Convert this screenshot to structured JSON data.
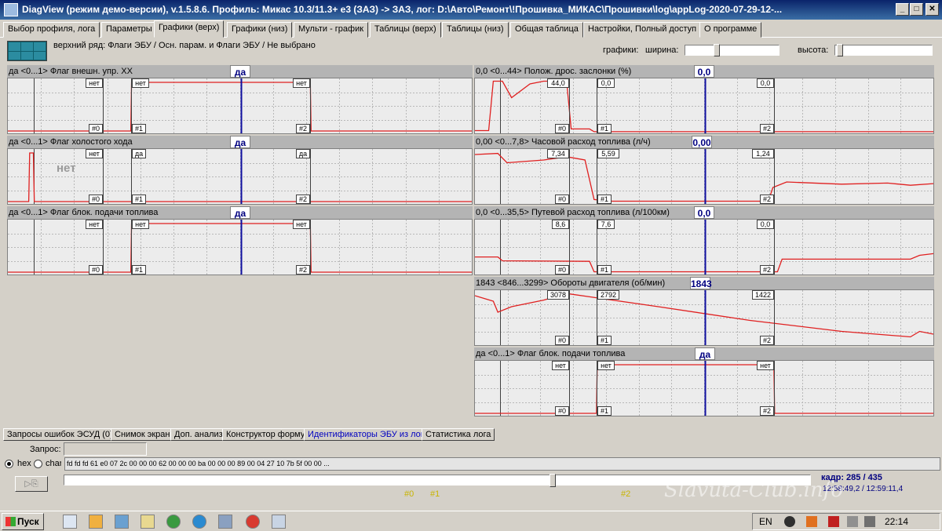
{
  "window": {
    "title": "DiagView (режим демо-версии), v.1.5.8.6. Профиль: Микас 10.3/11.3+ е3 (ЗАЗ) -> ЗАЗ,   лог: D:\\Авто\\Ремонт\\!Прошивка_МИКАС\\Прошивки\\log\\appLog-2020-07-29-12-...",
    "min_label": "_",
    "max_label": "□",
    "close_label": "✕"
  },
  "tabs": [
    {
      "label": "Выбор профиля, лога",
      "active": false
    },
    {
      "label": "Параметры",
      "active": false
    },
    {
      "label": "Графики (верх)",
      "active": true
    },
    {
      "label": "Графики (низ)",
      "active": false
    },
    {
      "label": "Мульти - график",
      "active": false
    },
    {
      "label": "Таблицы (верх)",
      "active": false
    },
    {
      "label": "Таблицы (низ)",
      "active": false
    },
    {
      "label": "Общая таблица",
      "active": false
    },
    {
      "label": "Настройки, Полный доступ",
      "active": false
    },
    {
      "label": "О программе",
      "active": false
    }
  ],
  "subheader": {
    "row_desc": "верхний ряд: Флаги ЭБУ / Осн. парам. и Флаги ЭБУ / Не выбрано",
    "graphs_label": "графики:",
    "width_label": "ширина:",
    "height_label": "высота:",
    "width_level": 0.32,
    "height_level": 0.02
  },
  "markers": {
    "m0": "#0",
    "m1": "#1",
    "m2": "#2"
  },
  "left_panels": [
    {
      "value": "да",
      "range": "<0...1>",
      "name": "Флаг внешн. упр. ХХ",
      "current": "да",
      "labels": [
        "нет",
        "нет",
        "нет"
      ],
      "overlay": ""
    },
    {
      "value": "да",
      "range": "<0...1>",
      "name": "Флаг холостого хода",
      "current": "да",
      "labels": [
        "нет",
        "да",
        "да"
      ],
      "overlay": "нет"
    },
    {
      "value": "да",
      "range": "<0...1>",
      "name": "Флаг блок. подачи топлива",
      "current": "да",
      "labels": [
        "нет",
        "нет",
        "нет"
      ],
      "overlay": ""
    }
  ],
  "right_panels": [
    {
      "value": "0,0",
      "range": "<0...44>",
      "name": "Полож. дрос. заслонки (%)",
      "current": "0,0",
      "labels": [
        "44,0",
        "0,0",
        "0,0"
      ]
    },
    {
      "value": "0,00",
      "range": "<0...7,8>",
      "name": "Часовой расход топлива (л/ч)",
      "current": "0,00",
      "labels": [
        "7,34",
        "5,59",
        "1,24"
      ]
    },
    {
      "value": "0,0",
      "range": "<0...35,5>",
      "name": "Путевой расход топлива (л/100км)",
      "current": "0,0",
      "labels": [
        "8,6",
        "7,6",
        "0,0"
      ]
    },
    {
      "value": "1843",
      "range": "<846...3299>",
      "name": "Обороты двигателя (об/мин)",
      "current": "1843",
      "labels": [
        "3078",
        "2792",
        "1422"
      ]
    },
    {
      "value": "да",
      "range": "<0...1>",
      "name": "Флаг блок. подачи топлива",
      "current": "да",
      "labels": [
        "нет",
        "нет",
        "нет"
      ]
    }
  ],
  "bottom_tabs": [
    {
      "label": "Запросы ошибок ЭСУД (0)",
      "blue": false
    },
    {
      "label": "Снимок экрана",
      "blue": false
    },
    {
      "label": "Доп. анализ",
      "blue": false
    },
    {
      "label": "Конструктор формул",
      "blue": false
    },
    {
      "label": "Идентификаторы ЭБУ из лога",
      "blue": true
    },
    {
      "label": "Статистика лога",
      "blue": false
    }
  ],
  "request": {
    "label": "Запрос:",
    "value": ""
  },
  "radios": {
    "hex": "hex",
    "char": "char",
    "selected": "hex"
  },
  "hex_data": "fd fd fd 61 e0 07 2c 00 00 00 62 00 00 00 ba 00 00 00 89 00 04 27 10 7b 5f 00 00 ...",
  "frame": {
    "label": "кадр: 285 / 435",
    "current": 285,
    "total": 435,
    "timestamp": "12:58:49,2 / 12:59:11,4"
  },
  "play_icon": "play-copy-icon",
  "watermark": "Slavuta-Club.info",
  "taskbar": {
    "start_label": "Пуск",
    "lang": "EN",
    "clock": "22:14"
  }
}
